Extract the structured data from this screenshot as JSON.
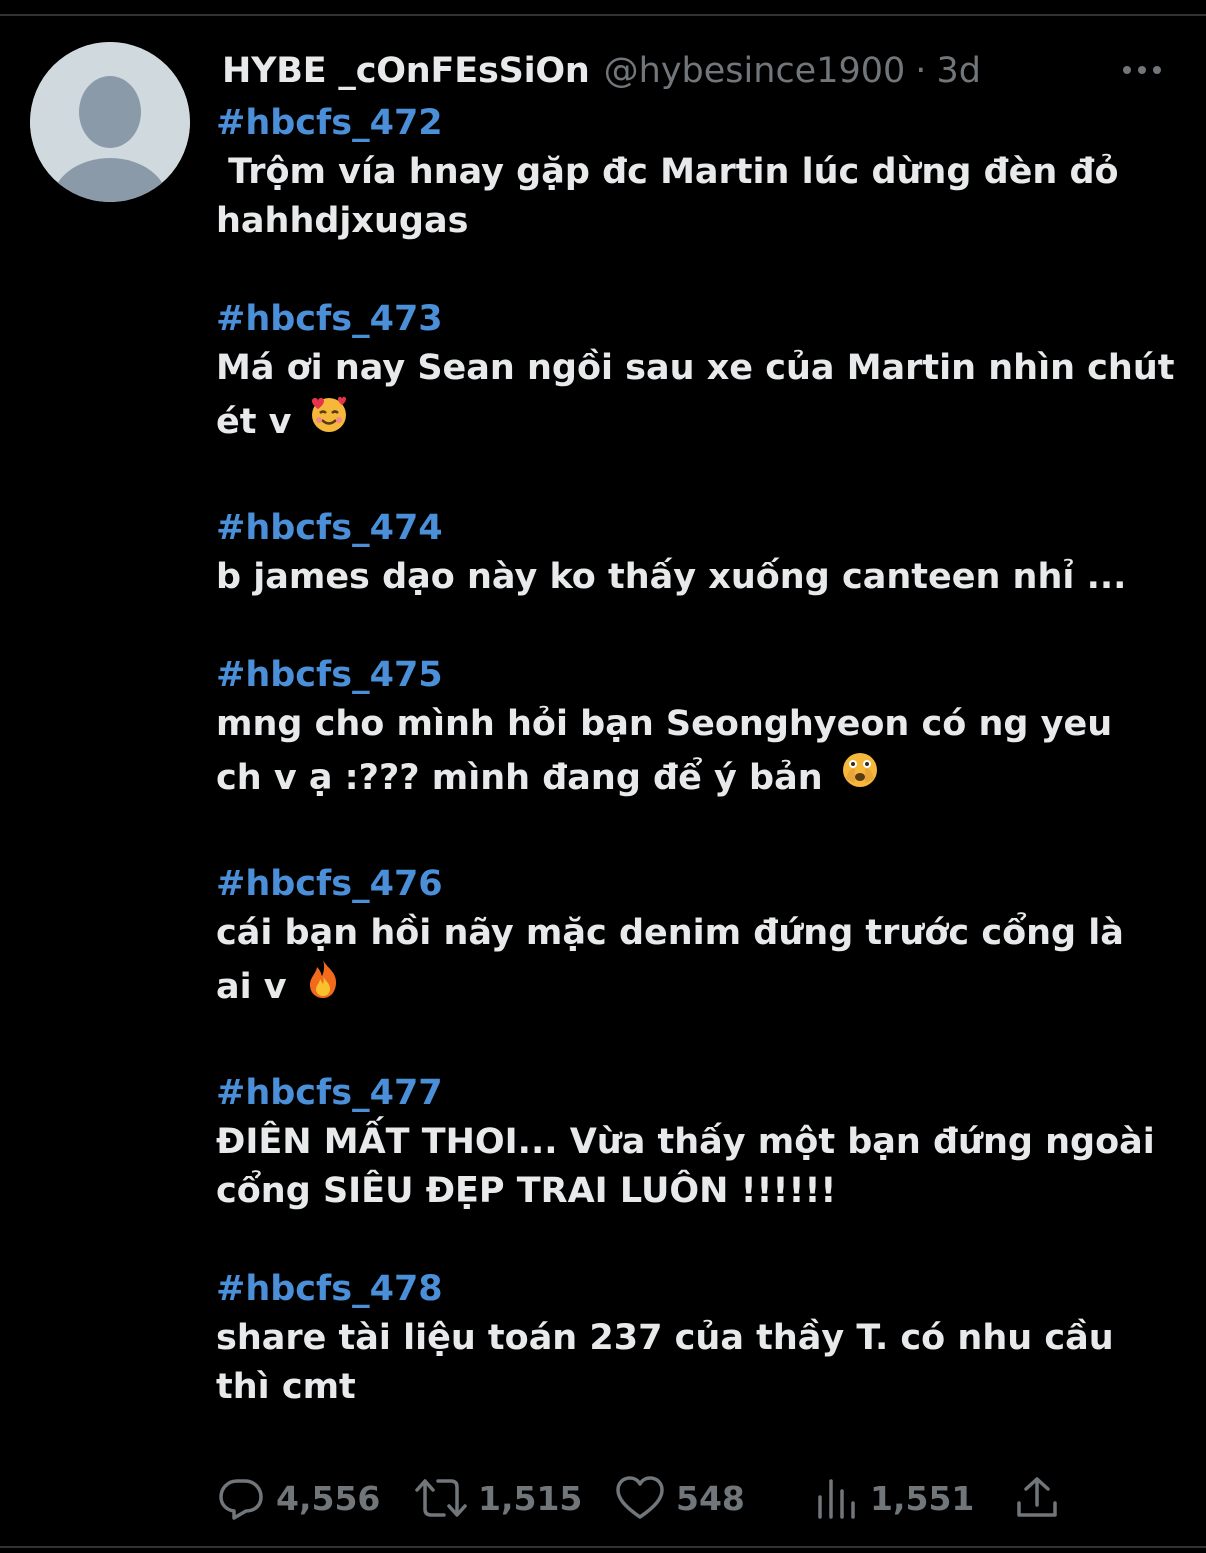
{
  "tweet": {
    "display_name": "HYBE _cOnFEsSiOn",
    "handle": "@hybesince1900",
    "separator": "·",
    "time": "3d",
    "avatar": "default-avatar",
    "entries": [
      {
        "tag": "#hbcfs_472",
        "lines": [
          " Trộm vía hnay gặp đc Martin lúc dừng đèn đỏ",
          "hahhdjxugas"
        ]
      },
      {
        "tag": "#hbcfs_473",
        "lines": [
          "Má ơi nay Sean ngồi sau xe của Martin nhìn chút",
          "ét v"
        ],
        "emoji": "smiling-face-with-hearts-icon"
      },
      {
        "tag": "#hbcfs_474",
        "lines": [
          "b james dạo này ko thấy xuống canteen nhỉ ..."
        ]
      },
      {
        "tag": "#hbcfs_475",
        "lines": [
          "mng cho mình hỏi bạn Seonghyeon có ng yeu",
          "ch v ạ :??? mình đang để ý bản"
        ],
        "emoji": "face-with-open-eyes-and-hand-over-mouth-icon"
      },
      {
        "tag": "#hbcfs_476",
        "lines": [
          "cái bạn hồi nãy mặc denim đứng trước cổng là",
          "ai v"
        ],
        "emoji": "fire-icon"
      },
      {
        "tag": "#hbcfs_477",
        "lines": [
          "ĐIÊN MẤT THOI... Vừa thấy một bạn đứng ngoài",
          "cổng SIÊU ĐẸP TRAI LUÔN !!!!!!"
        ]
      },
      {
        "tag": "#hbcfs_478",
        "lines": [
          "share tài liệu toán 237 của thầy T. có nhu cầu",
          "thì cmt"
        ]
      }
    ],
    "stats": {
      "replies": "4,556",
      "retweets": "1,515",
      "likes": "548",
      "views": "1,551"
    },
    "icons": [
      "more-icon",
      "reply-icon",
      "retweet-icon",
      "like-icon",
      "views-icon",
      "share-icon"
    ]
  },
  "colors": {
    "background": "#000000",
    "text": "#e7e9ea",
    "muted": "#71767b",
    "hashtag": "#4a8fd8"
  }
}
